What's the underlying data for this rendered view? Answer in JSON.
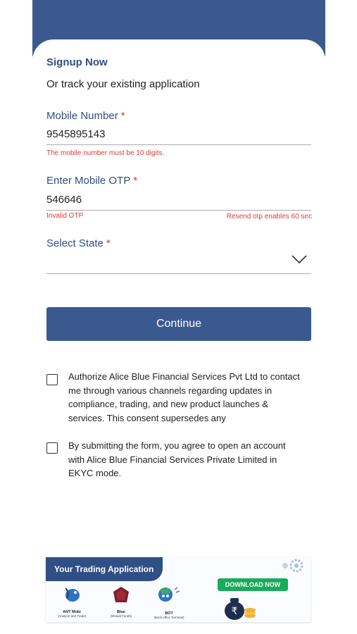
{
  "form": {
    "title": "Signup Now",
    "subtitle": "Or track your existing application",
    "mobile": {
      "label": "Mobile Number",
      "required": "*",
      "value": "9545895143",
      "error": "The mobile number must be 10 digits."
    },
    "otp": {
      "label": "Enter Mobile OTP",
      "required": "*",
      "value": "546646",
      "error": "Invalid OTP",
      "resend": "Resend otp enables 60 sec"
    },
    "state": {
      "label": "Select State",
      "required": "*",
      "value": ""
    },
    "continue_label": "Continue"
  },
  "consents": [
    {
      "text": "Authorize Alice Blue Financial Services Pvt Ltd to contact me through various channels regarding updates in compliance, trading, and new product launches & services. This consent supersedes any",
      "checked": false
    },
    {
      "text": "By submitting the form, you agree to open an account with Alice Blue Financial Services Private Limited in EKYC mode.",
      "checked": false
    }
  ],
  "banner": {
    "title": "Your Trading Application",
    "download_label": "DOWNLOAD NOW",
    "apps": [
      {
        "name": "ANT Mobi",
        "sub": "(Analyze and Trade)",
        "icon": "ant-mobi-icon"
      },
      {
        "name": "Blue",
        "sub": "(Mutual Funds)",
        "icon": "blue-mf-icon"
      },
      {
        "name": "BOT",
        "sub": "(Back office Terminal)",
        "icon": "bot-icon"
      }
    ],
    "rupee_symbol": "₹"
  },
  "colors": {
    "primary": "#3a5a8f",
    "label": "#324e82",
    "error": "#e53935",
    "download": "#1aab5a"
  }
}
